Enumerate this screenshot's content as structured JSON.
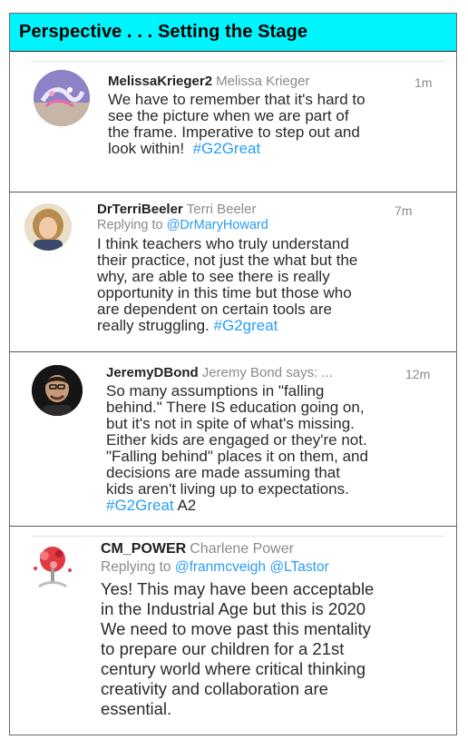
{
  "header": {
    "title": "Perspective . . . Setting the Stage"
  },
  "tweets": [
    {
      "display_name": "MelissaKrieger2",
      "handle": "Melissa Krieger",
      "time": "1m",
      "lines": [
        "We have to remember that it's hard to",
        "see the picture when we are part of",
        "the frame. Imperative to step out and",
        "look within!"
      ],
      "hashtag": "#G2Great"
    },
    {
      "display_name": "DrTerriBeeler",
      "handle": "Terri Beeler",
      "time": "7m",
      "reply_prefix": "Replying to",
      "reply_to": "@DrMaryHoward",
      "lines": [
        "I think teachers who truly understand",
        "their practice, not just the what but the",
        "why, are able to see there is really",
        "opportunity in this time but those who",
        "are dependent on certain tools are",
        "really struggling."
      ],
      "hashtag": "#G2great"
    },
    {
      "display_name": "JeremyDBond",
      "handle": "Jeremy Bond says: ...",
      "time": "12m",
      "lines": [
        "So many assumptions in \"falling",
        "behind.\" There IS education going on,",
        "but it's not in spite of what's missing.",
        "Either kids are engaged or they're not.",
        "\"Falling behind\" places it on them, and",
        "decisions are made assuming that",
        "kids aren't living up to expectations."
      ],
      "hashtag": "#G2Great",
      "suffix": "A2"
    },
    {
      "display_name": "CM_POWER",
      "handle": "Charlene Power",
      "reply_prefix": "Replying to",
      "reply_to": "@franmcveigh @LTastor",
      "lines": [
        "Yes! This may have been acceptable",
        "in the Industrial Age but this is 2020",
        "We need to move past this mentality",
        "to prepare our children for a 21st",
        "century world where critical thinking",
        "creativity and collaboration are",
        "essential."
      ]
    }
  ]
}
